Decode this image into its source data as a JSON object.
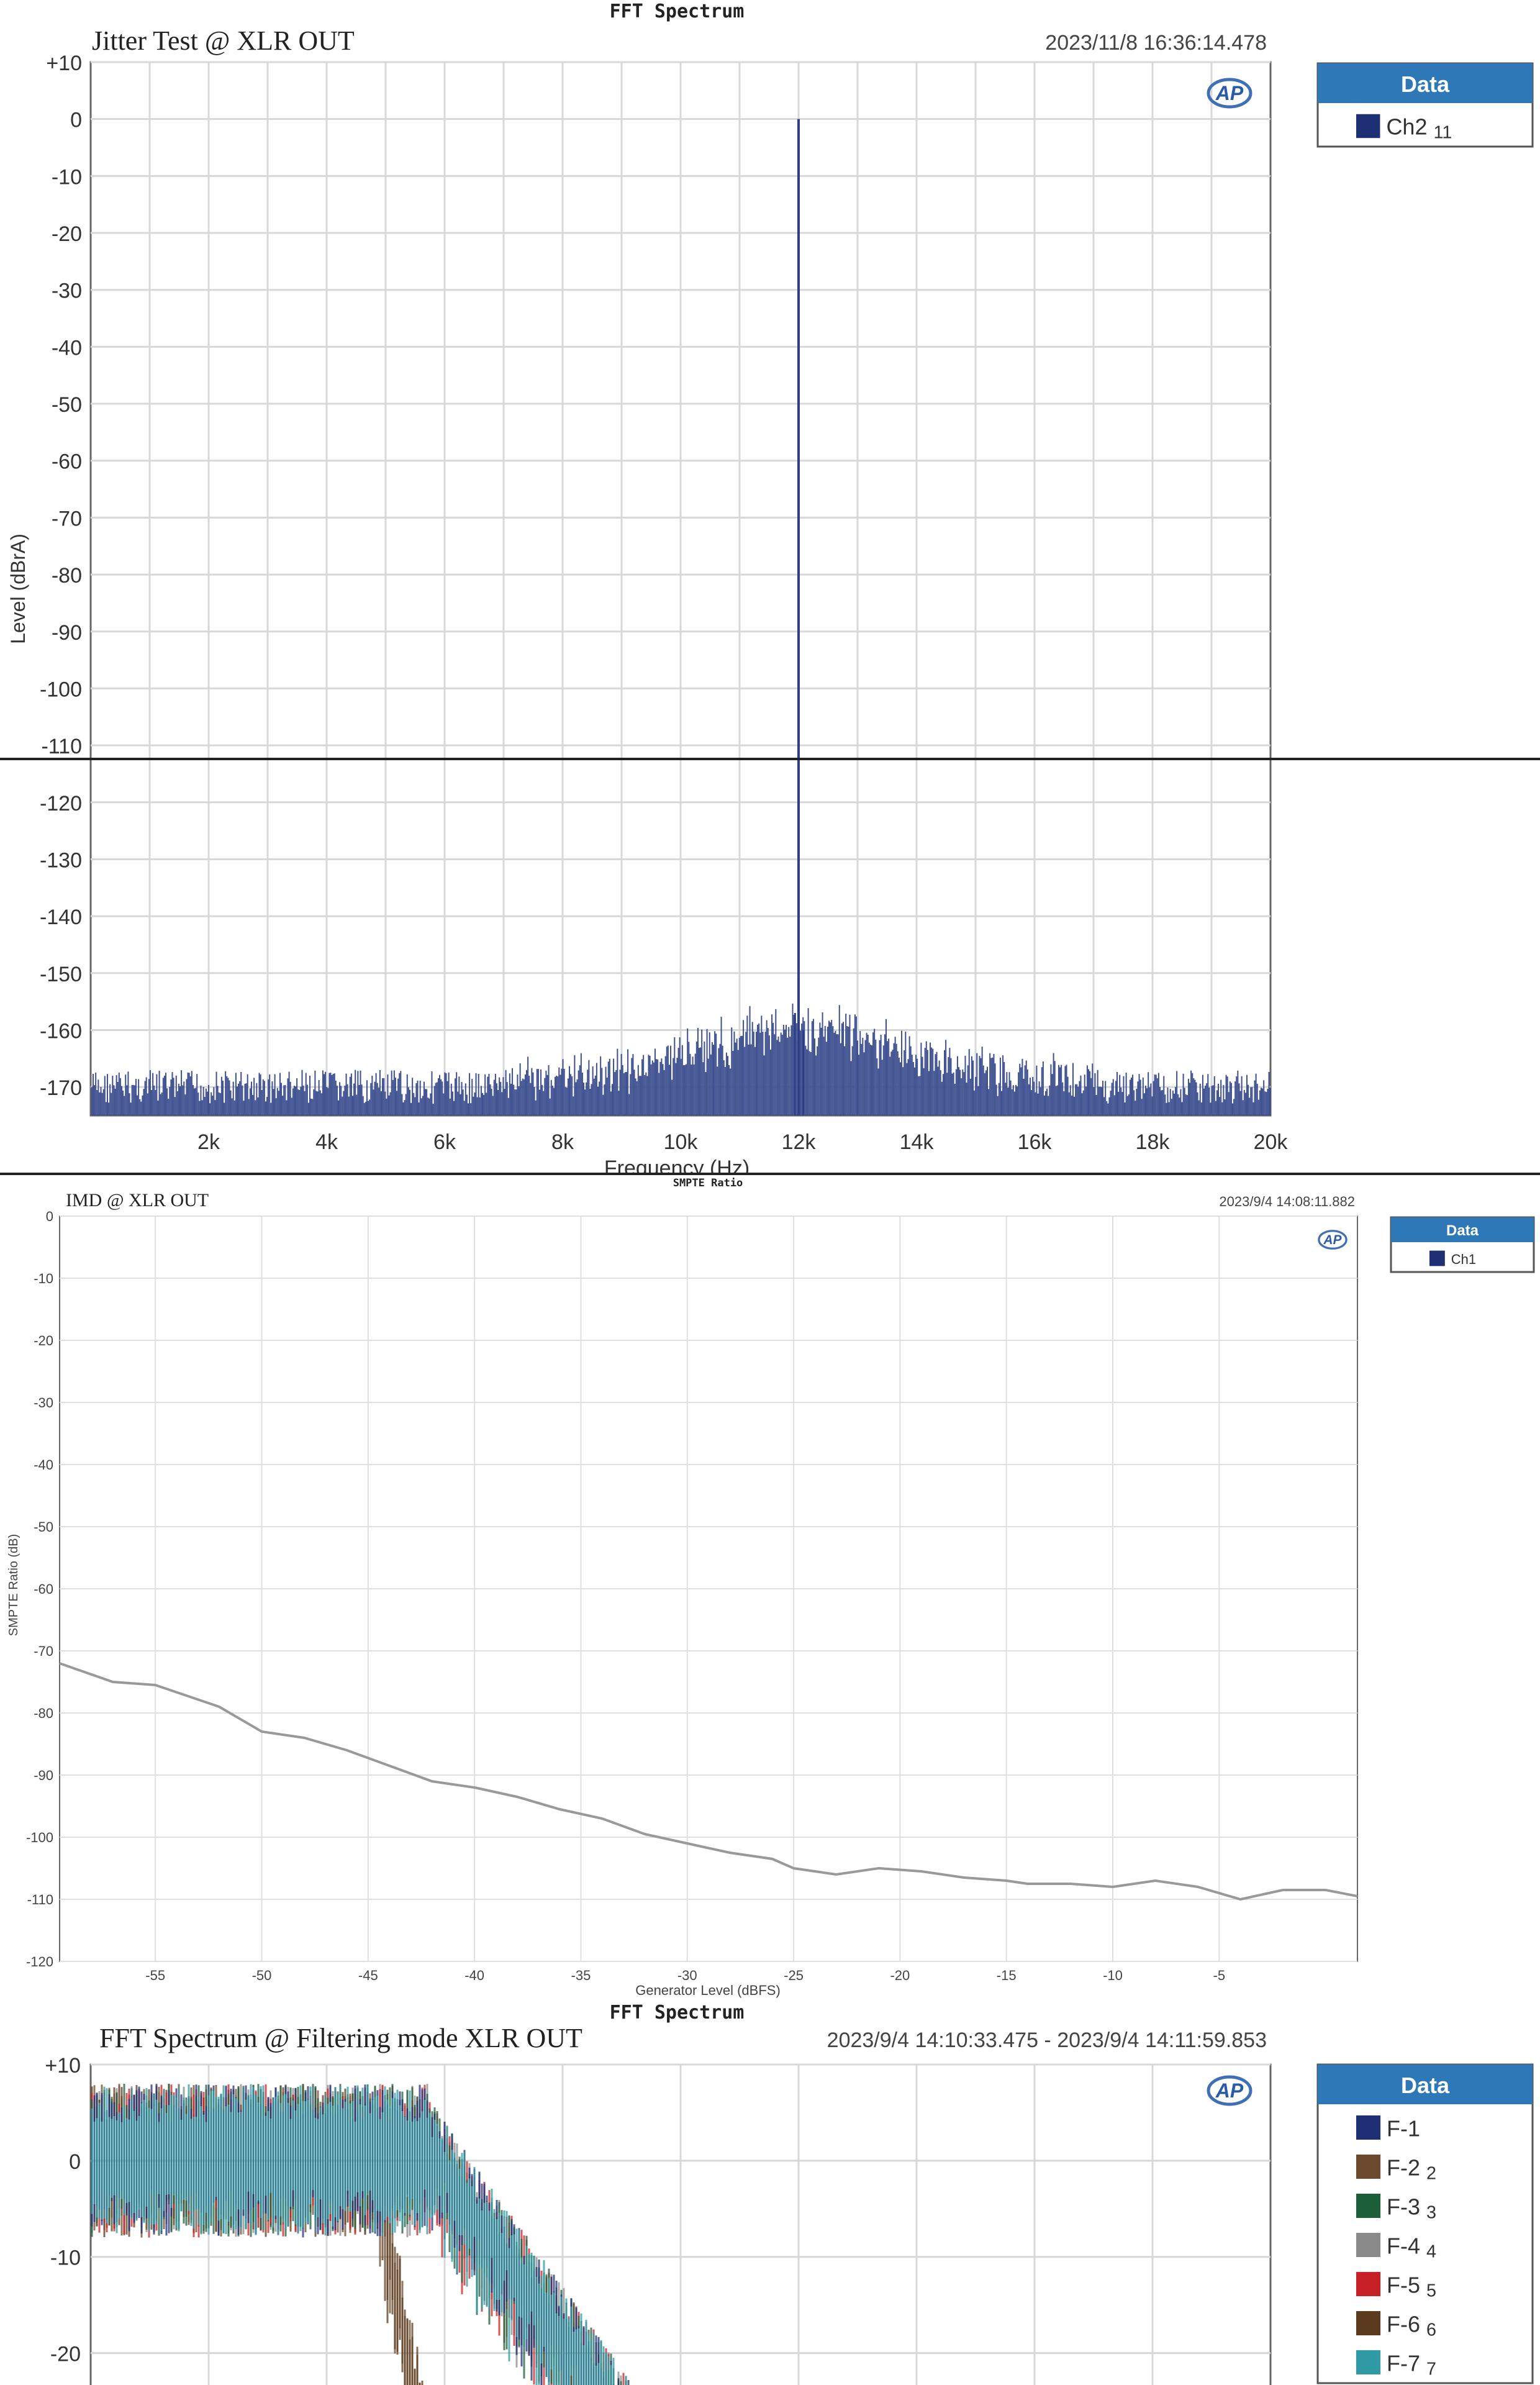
{
  "charts": [
    {
      "header": "FFT Spectrum",
      "title": "Jitter Test @ XLR OUT",
      "timestamp": "2023/11/8 16:36:14.478",
      "logo": "AP",
      "legend_header": "Data",
      "legend": [
        {
          "label": "Ch2",
          "sub": "11",
          "color": "#1f2f73"
        }
      ],
      "ylabel": "Level (dBrA)",
      "xlabel": "Frequency (Hz)",
      "yticks": [
        "+10",
        "0",
        "-10",
        "-20",
        "-30",
        "-40",
        "-50",
        "-60",
        "-70",
        "-80",
        "-90",
        "-100",
        "-110",
        "-120",
        "-130",
        "-140",
        "-150",
        "-160",
        "-170"
      ],
      "xticks": [
        "2k",
        "4k",
        "6k",
        "8k",
        "10k",
        "12k",
        "14k",
        "16k",
        "18k",
        "20k"
      ],
      "line_color": "#3d4f8f"
    },
    {
      "header": "SMPTE Ratio",
      "title": "IMD @ XLR OUT",
      "timestamp": "2023/9/4 14:08:11.882",
      "logo": "AP",
      "legend_header": "Data",
      "legend": [
        {
          "label": "Ch1",
          "sub": "",
          "color": "#1f2f73"
        }
      ],
      "ylabel": "SMPTE Ratio (dB)",
      "xlabel": "Generator Level (dBFS)",
      "yticks": [
        "0",
        "-10",
        "-20",
        "-30",
        "-40",
        "-50",
        "-60",
        "-70",
        "-80",
        "-90",
        "-100",
        "-110",
        "-120"
      ],
      "xticks": [
        "-55",
        "-50",
        "-45",
        "-40",
        "-35",
        "-30",
        "-25",
        "-20",
        "-15",
        "-10",
        "-5"
      ],
      "line_color": "#999999"
    },
    {
      "header": "FFT Spectrum",
      "title": "FFT Spectrum @ Filtering mode XLR OUT",
      "timestamp": "2023/9/4 14:10:33.475 - 2023/9/4 14:11:59.853",
      "logo": "AP",
      "legend_header": "Data",
      "legend": [
        {
          "label": "F-1",
          "sub": "",
          "color": "#1f2f73"
        },
        {
          "label": "F-2",
          "sub": "2",
          "color": "#6b4a2e"
        },
        {
          "label": "F-3",
          "sub": "3",
          "color": "#1c5e3a"
        },
        {
          "label": "F-4",
          "sub": "4",
          "color": "#8a8a8a"
        },
        {
          "label": "F-5",
          "sub": "5",
          "color": "#c62026"
        },
        {
          "label": "F-6",
          "sub": "6",
          "color": "#5c3a1e"
        },
        {
          "label": "F-7",
          "sub": "7",
          "color": "#2f9aa3"
        }
      ],
      "yticks": [
        "+10",
        "0",
        "-10",
        "-20"
      ],
      "xticks": []
    }
  ],
  "chart_data": [
    {
      "type": "line",
      "title": "Jitter Test @ XLR OUT",
      "xlabel": "Frequency (Hz)",
      "ylabel": "Level (dBrA)",
      "xlim": [
        0,
        20000
      ],
      "ylim": [
        -175,
        10
      ],
      "grid": true,
      "legend_position": "right",
      "series": [
        {
          "name": "Ch2",
          "peak_hz": 12000,
          "peak_db": 0,
          "noise_floor_db": -170
        }
      ]
    },
    {
      "type": "line",
      "title": "IMD @ XLR OUT",
      "xlabel": "Generator Level (dBFS)",
      "ylabel": "SMPTE Ratio (dB)",
      "xlim": [
        -59.5,
        1.5
      ],
      "ylim": [
        -120,
        0
      ],
      "grid": true,
      "legend_position": "right",
      "x": [
        -59.5,
        -57,
        -55,
        -52,
        -50,
        -48,
        -46,
        -44,
        -42,
        -40,
        -38,
        -36,
        -34,
        -32,
        -30,
        -28,
        -26,
        -25,
        -23,
        -21,
        -19,
        -17,
        -15,
        -14,
        -12,
        -10,
        -8,
        -6,
        -4,
        -2,
        0,
        1.5
      ],
      "series": [
        {
          "name": "Ch1",
          "values": [
            -72,
            -75,
            -75.5,
            -79,
            -83,
            -84,
            -86,
            -88.5,
            -91,
            -92,
            -93.5,
            -95.5,
            -97,
            -99.5,
            -101,
            -102.5,
            -103.5,
            -105,
            -106,
            -105,
            -105.5,
            -106.5,
            -107,
            -107.5,
            -107.5,
            -108,
            -107,
            -108,
            -110,
            -108.5,
            -108.5,
            -109.5
          ]
        }
      ]
    },
    {
      "type": "area",
      "title": "FFT Spectrum @ Filtering mode XLR OUT",
      "ylim": [
        -25,
        10
      ],
      "grid": true,
      "legend_position": "right",
      "series": [
        {
          "name": "F-1",
          "cutoff_frac": 0.31
        },
        {
          "name": "F-2",
          "cutoff_frac": 0.26
        },
        {
          "name": "F-3",
          "cutoff_frac": 0.31
        },
        {
          "name": "F-4",
          "cutoff_frac": 0.31
        },
        {
          "name": "F-5",
          "cutoff_frac": 0.31
        },
        {
          "name": "F-6",
          "cutoff_frac": 0.26
        },
        {
          "name": "F-7",
          "cutoff_frac": 0.31
        }
      ]
    }
  ]
}
